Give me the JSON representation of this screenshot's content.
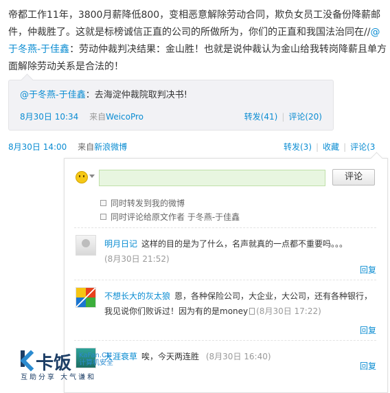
{
  "post": {
    "text_before_mention": "帝都工作11年，3800月薪降低800，变相恶意解除劳动合同，欺负女员工没备份降薪邮件，仲裁胜了。这就是标榜诚信正直的公司的所做所为，你们的正直和我国法治同在//",
    "mention": "@于冬燕-于佳鑫",
    "text_after_mention": "：劳动仲裁判决结果：金山胜！也就是说仲裁认为金山给我转岗降薪且单方面解除劳动关系是合法的！",
    "time": "8月30日 14:00",
    "source_prefix": "来自",
    "source": "新浪微博",
    "actions": {
      "repost": "转发(3)",
      "favorite": "收藏",
      "comment": "评论(3"
    }
  },
  "repost": {
    "author": "@于冬燕-于佳鑫",
    "text": "：去海淀仲裁院取判决书!",
    "time": "8月30日 10:34",
    "source_prefix": "来自",
    "source": "WeicoPro",
    "repost_count": "转发(41)",
    "comment_count": "评论(20)"
  },
  "comment_box": {
    "input_value": "",
    "submit_label": "评论",
    "option_repost": "同时转发到我的微博",
    "option_comment_origin": "同时评论给原文作者  于冬燕-于佳鑫"
  },
  "comments": [
    {
      "user": "明月日记",
      "text": "这样的目的是为了什么，名声就真的一点都不重要吗。。。",
      "time": "(8月30日 21:52)",
      "reply": "回复"
    },
    {
      "user": "不想长大的灰太狼",
      "text_before_icon": "恩，各种保险公司，大企业，大公司，还有各种银行，我见说你们败诉过！因为有的是money",
      "time": "(8月30日 17:22)",
      "reply": "回复"
    },
    {
      "user": "天涯衰草",
      "text": "唉，今天两连胜",
      "time": "(8月30日 16:40)",
      "reply": "回复"
    }
  ],
  "watermark": {
    "brand": "卡饭",
    "domain": "KaFan.CN",
    "tagline": "计算机安全",
    "slogan": "互助分享   大气谦和"
  }
}
